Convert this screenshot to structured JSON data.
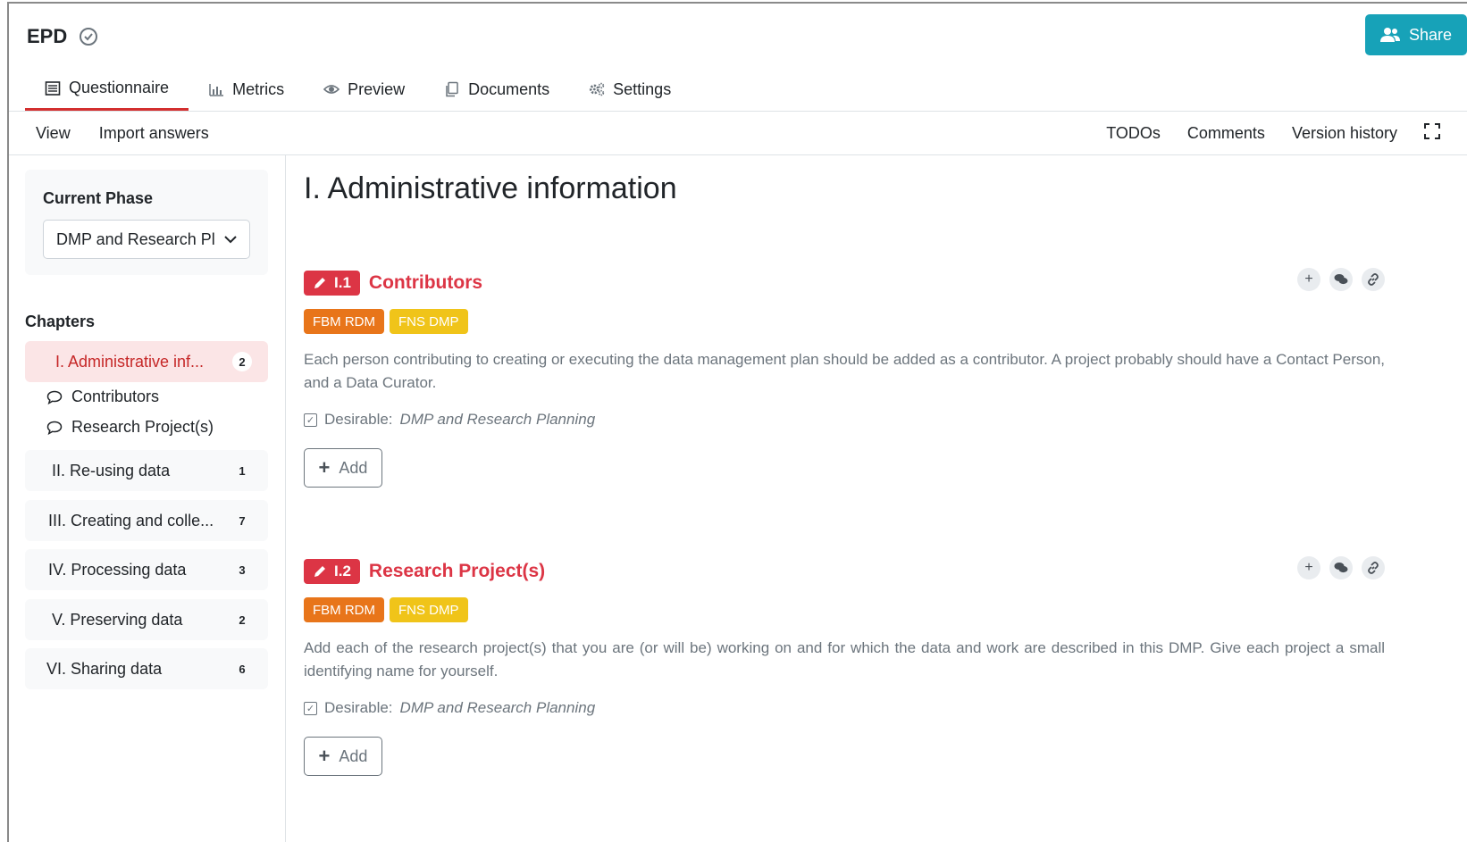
{
  "header": {
    "project_name": "EPD",
    "share_label": "Share"
  },
  "tabs": [
    {
      "label": "Questionnaire",
      "icon": "list-icon"
    },
    {
      "label": "Metrics",
      "icon": "bar-chart-icon"
    },
    {
      "label": "Preview",
      "icon": "eye-icon"
    },
    {
      "label": "Documents",
      "icon": "copy-icon"
    },
    {
      "label": "Settings",
      "icon": "gears-icon"
    }
  ],
  "toolbar": {
    "view": "View",
    "import_answers": "Import answers",
    "todos": "TODOs",
    "comments": "Comments",
    "version_history": "Version history"
  },
  "sidebar": {
    "phase_label": "Current Phase",
    "phase_value": "DMP and Research Pl",
    "chapters_label": "Chapters",
    "chapters": [
      {
        "label": "I.  Administrative inf...",
        "count": "2"
      },
      {
        "label": "II.  Re-using data",
        "count": "1"
      },
      {
        "label": "III.  Creating and colle...",
        "count": "7"
      },
      {
        "label": "IV.  Processing data",
        "count": "3"
      },
      {
        "label": "V.  Preserving data",
        "count": "2"
      },
      {
        "label": "VI.  Sharing data",
        "count": "6"
      }
    ],
    "subitems": [
      "Contributors",
      "Research Project(s)"
    ]
  },
  "main": {
    "title": "I. Administrative information",
    "questions": [
      {
        "number": "I.1",
        "title": "Contributors",
        "tags": [
          "FBM RDM",
          "FNS DMP"
        ],
        "description": "Each person contributing to creating or executing the data management plan should be added as a contributor. A project probably should have a Contact Person, and a Data Curator.",
        "desirable_label": "Desirable:",
        "desirable_value": "DMP and Research Planning",
        "add_label": "Add"
      },
      {
        "number": "I.2",
        "title": "Research Project(s)",
        "tags": [
          "FBM RDM",
          "FNS DMP"
        ],
        "description": "Add each of the research project(s) that you are (or will be) working on and for which the data and work are described in this DMP. Give each project a small identifying name for yourself.",
        "desirable_label": "Desirable:",
        "desirable_value": "DMP and Research Planning",
        "add_label": "Add"
      }
    ]
  },
  "colors": {
    "accent": "#17a2b8",
    "danger": "#dc3545",
    "tag_orange": "#e8751a",
    "tag_yellow": "#f0c419"
  }
}
